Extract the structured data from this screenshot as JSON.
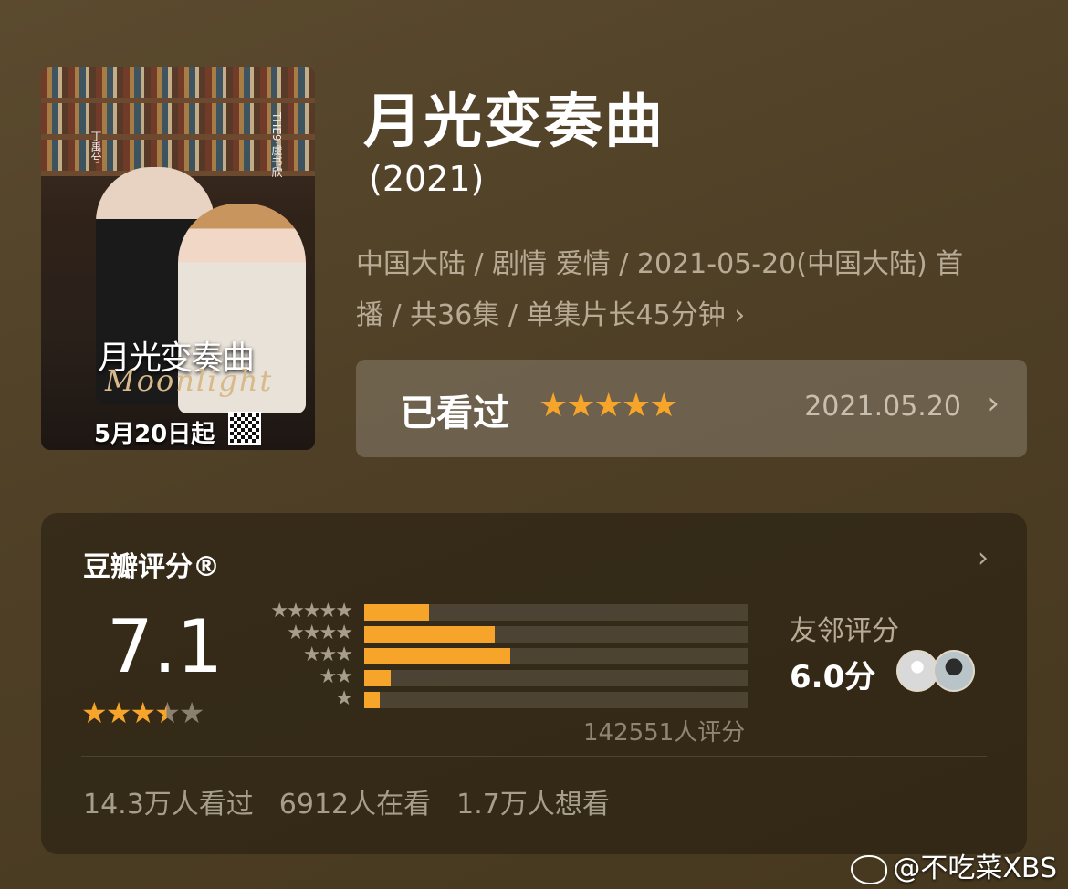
{
  "poster": {
    "title_art": "月光变奏曲",
    "script_art": "Moonlight",
    "date_text": "5月20日起",
    "left_name": "丁禹兮",
    "right_name": "THE9·虞书欣"
  },
  "header": {
    "title": "月光变奏曲",
    "year": "(2021)",
    "meta_line1": "中国大陆 / 剧情 爱情 / 2021-05-20(中国大陆) 首",
    "meta_line2": "播 / 共36集 / 单集片长45分钟"
  },
  "watched": {
    "label": "已看过",
    "stars": "★★★★★",
    "date": "2021.05.20"
  },
  "douban": {
    "title": "豆瓣评分®",
    "score": "7.1",
    "stars_rating": 3.5,
    "distribution": [
      {
        "stars": "★★★★★",
        "percent": 17
      },
      {
        "stars": "★★★★",
        "percent": 34
      },
      {
        "stars": "★★★",
        "percent": 38
      },
      {
        "stars": "★★",
        "percent": 7
      },
      {
        "stars": "★",
        "percent": 4
      }
    ],
    "votes_text": "142551人评分",
    "friends_label": "友邻评分",
    "friends_score": "6.0分",
    "stats": [
      "14.3万人看过",
      "6912人在看",
      "1.7万人想看"
    ]
  },
  "colors": {
    "accent": "#f7a52a",
    "background": "#4e3f26"
  },
  "icons": {
    "chevron": "chevron-right-icon",
    "watermark_logo": "weibo-icon"
  },
  "watermark": {
    "text": "@不吃菜XBS"
  }
}
